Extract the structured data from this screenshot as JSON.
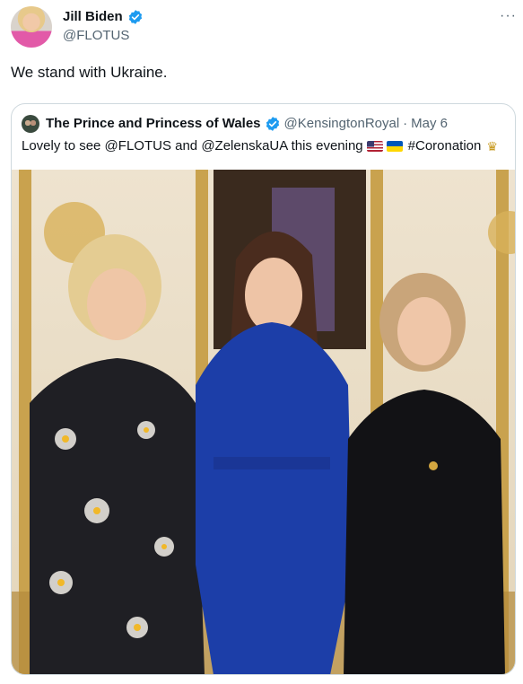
{
  "author": {
    "display_name": "Jill Biden",
    "handle": "@FLOTUS",
    "verified": true
  },
  "menu": {
    "more_label": "···"
  },
  "tweet": {
    "text": "We stand with Ukraine."
  },
  "quoted": {
    "display_name": "The Prince and Princess of Wales",
    "handle": "@KensingtonRoyal",
    "separator": "·",
    "date": "May 6",
    "text_main": "Lovely to see @FLOTUS and @ZelenskaUA this evening",
    "hashtag": "#Coronation",
    "emoji": [
      "flag-united-states",
      "flag-ukraine",
      "crown"
    ]
  },
  "colors": {
    "verified_blue": "#1d9bf0",
    "secondary_text": "#536471",
    "border": "#cfd9de",
    "primary_text": "#0f1419"
  }
}
